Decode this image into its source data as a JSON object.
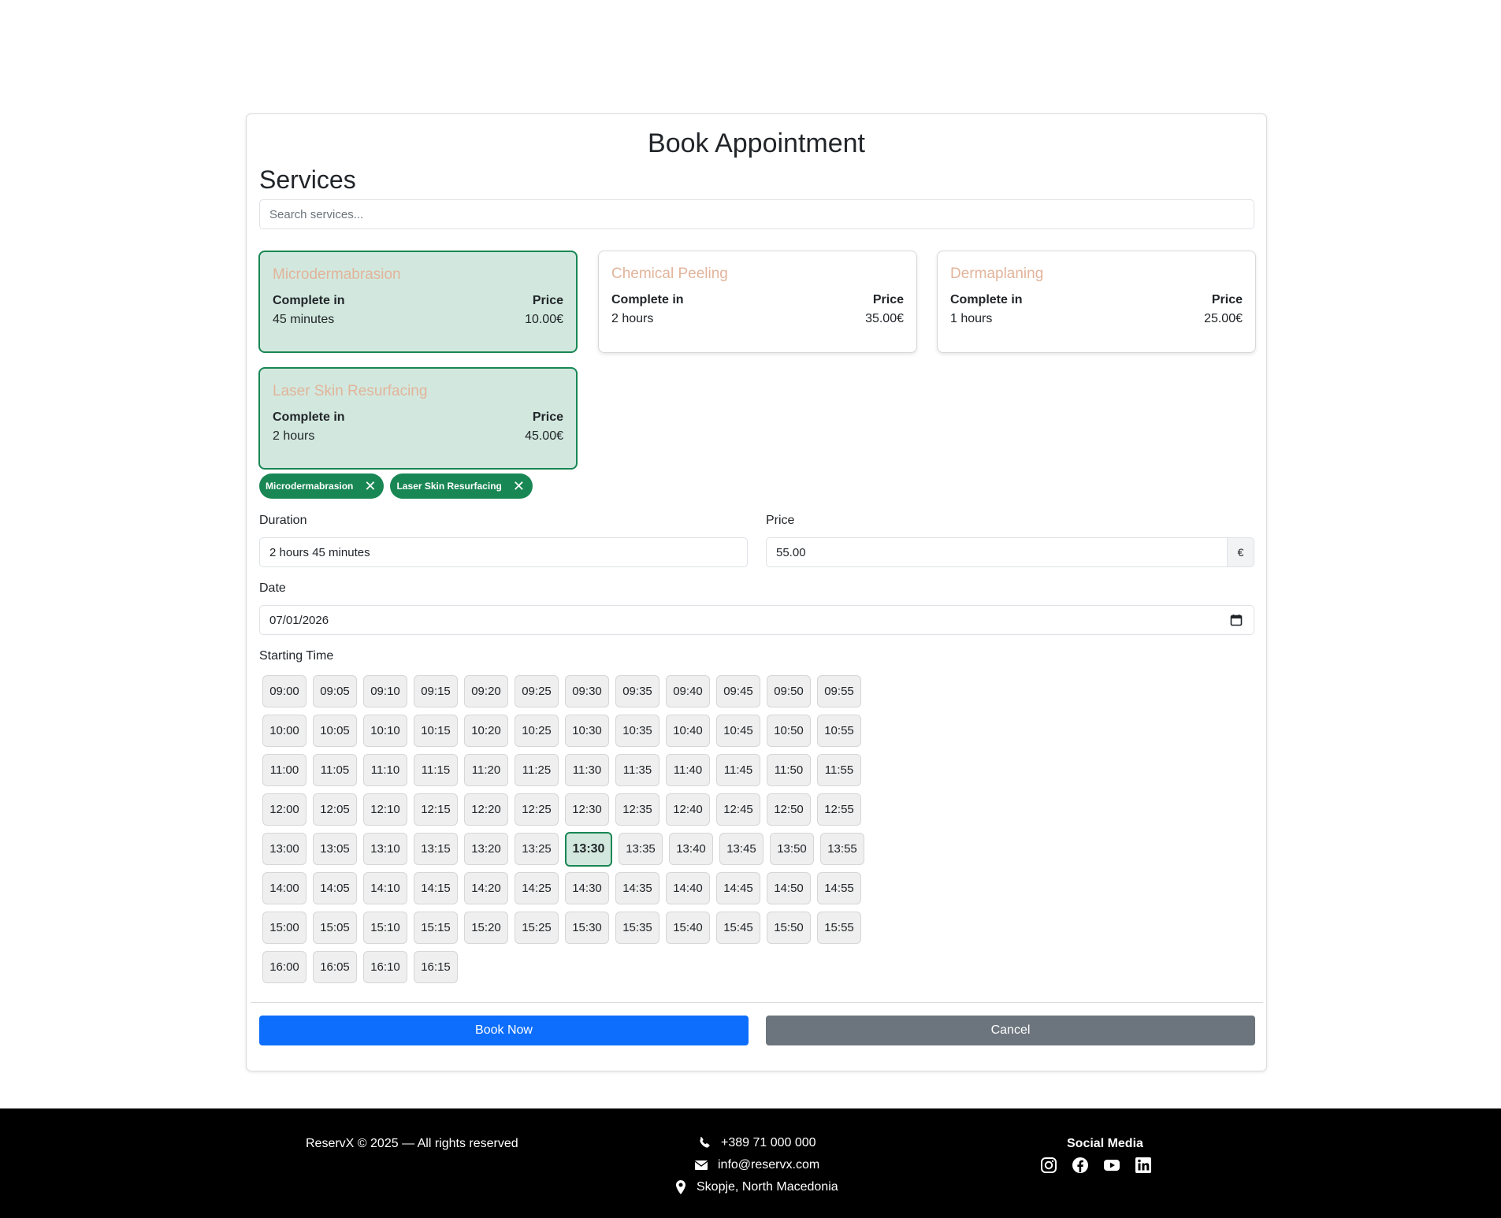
{
  "page": {
    "title": "Book Appointment"
  },
  "services_section": {
    "title": "Services",
    "search_placeholder": "Search services...",
    "complete_label": "Complete in",
    "price_label": "Price",
    "items": [
      {
        "name": "Microdermabrasion",
        "duration": "45 minutes",
        "price": "10.00€",
        "selected": true
      },
      {
        "name": "Chemical Peeling",
        "duration": "2 hours",
        "price": "35.00€",
        "selected": false
      },
      {
        "name": "Dermaplaning",
        "duration": "1 hours",
        "price": "25.00€",
        "selected": false
      },
      {
        "name": "Laser Skin Resurfacing",
        "duration": "2 hours",
        "price": "45.00€",
        "selected": true
      }
    ]
  },
  "selected_chips": [
    "Microdermabrasion",
    "Laser Skin Resurfacing"
  ],
  "form": {
    "duration_label": "Duration",
    "duration_value": "2 hours 45 minutes",
    "price_label": "Price",
    "price_value": "55.00",
    "currency": "€",
    "date_label": "Date",
    "date_value": "07/01/2026",
    "time_label": "Starting Time",
    "selected_time": "13:30",
    "times": [
      [
        "09:00",
        "09:05",
        "09:10",
        "09:15",
        "09:20",
        "09:25",
        "09:30",
        "09:35",
        "09:40",
        "09:45",
        "09:50",
        "09:55"
      ],
      [
        "10:00",
        "10:05",
        "10:10",
        "10:15",
        "10:20",
        "10:25",
        "10:30",
        "10:35",
        "10:40",
        "10:45",
        "10:50",
        "10:55"
      ],
      [
        "11:00",
        "11:05",
        "11:10",
        "11:15",
        "11:20",
        "11:25",
        "11:30",
        "11:35",
        "11:40",
        "11:45",
        "11:50",
        "11:55"
      ],
      [
        "12:00",
        "12:05",
        "12:10",
        "12:15",
        "12:20",
        "12:25",
        "12:30",
        "12:35",
        "12:40",
        "12:45",
        "12:50",
        "12:55"
      ],
      [
        "13:00",
        "13:05",
        "13:10",
        "13:15",
        "13:20",
        "13:25",
        "13:30",
        "13:35",
        "13:40",
        "13:45",
        "13:50",
        "13:55"
      ],
      [
        "14:00",
        "14:05",
        "14:10",
        "14:15",
        "14:20",
        "14:25",
        "14:30",
        "14:35",
        "14:40",
        "14:45",
        "14:50",
        "14:55"
      ],
      [
        "15:00",
        "15:05",
        "15:10",
        "15:15",
        "15:20",
        "15:25",
        "15:30",
        "15:35",
        "15:40",
        "15:45",
        "15:50",
        "15:55"
      ],
      [
        "16:00",
        "16:05",
        "16:10",
        "16:15"
      ]
    ]
  },
  "actions": {
    "book_label": "Book Now",
    "cancel_label": "Cancel"
  },
  "footer": {
    "copyright": "ReservX © 2025 — All rights reserved",
    "phone": "+389 71 000 000",
    "email": "info@reservx.com",
    "location": "Skopje, North Macedonia",
    "social_title": "Social Media",
    "social_icons": [
      "instagram-icon",
      "facebook-icon",
      "youtube-icon",
      "linkedin-icon"
    ]
  },
  "colors": {
    "accent_green": "#198754",
    "selected_bg": "#d2e8de",
    "primary_blue": "#0d6efd",
    "secondary_gray": "#6c757d",
    "service_name": "#e2b49b"
  }
}
